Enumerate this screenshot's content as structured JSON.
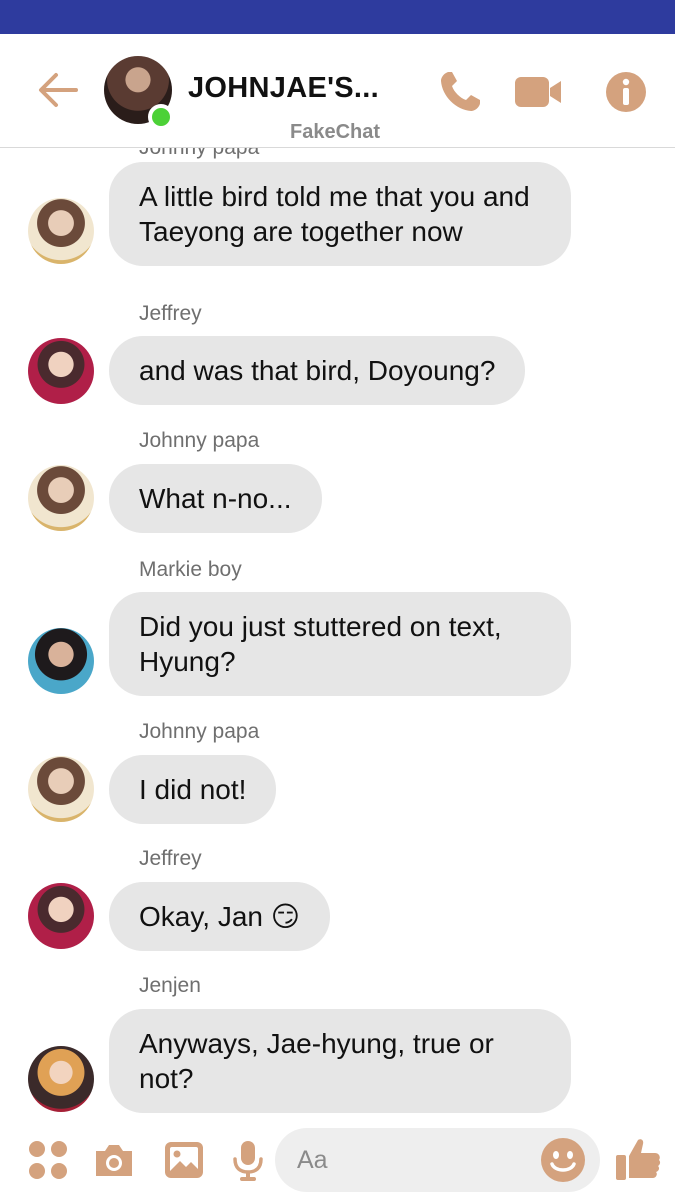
{
  "header": {
    "title": "JOHNJAE'S...",
    "app_name": "FakeChat",
    "status": "online"
  },
  "icons": {
    "back": "arrow-left-icon",
    "call": "phone-icon",
    "video": "video-camera-icon",
    "info": "info-icon",
    "menu": "four-dots-icon",
    "camera": "camera-icon",
    "gallery": "image-icon",
    "mic": "microphone-icon",
    "emoji": "smiley-icon",
    "like": "thumbs-up-icon"
  },
  "colors": {
    "accent": "#d4a27e",
    "status_bar": "#2e3b9e",
    "bubble": "#e6e6e6",
    "online": "#4cd137"
  },
  "messages": [
    {
      "sender": "Johnny papa",
      "text": "A little bird told me that you and Taeyong are together now"
    },
    {
      "sender": "Jeffrey",
      "text": "and was that bird, Doyoung?"
    },
    {
      "sender": "Johnny papa",
      "text": "What n-no..."
    },
    {
      "sender": "Markie boy",
      "text": "Did you just stuttered on text, Hyung?"
    },
    {
      "sender": "Johnny papa",
      "text": "I did not!"
    },
    {
      "sender": "Jeffrey",
      "text": "Okay, Jan 😏"
    },
    {
      "sender": "Jenjen",
      "text": "Anyways, Jae-hyung, true or not?"
    }
  ],
  "composer": {
    "placeholder": "Aa"
  }
}
